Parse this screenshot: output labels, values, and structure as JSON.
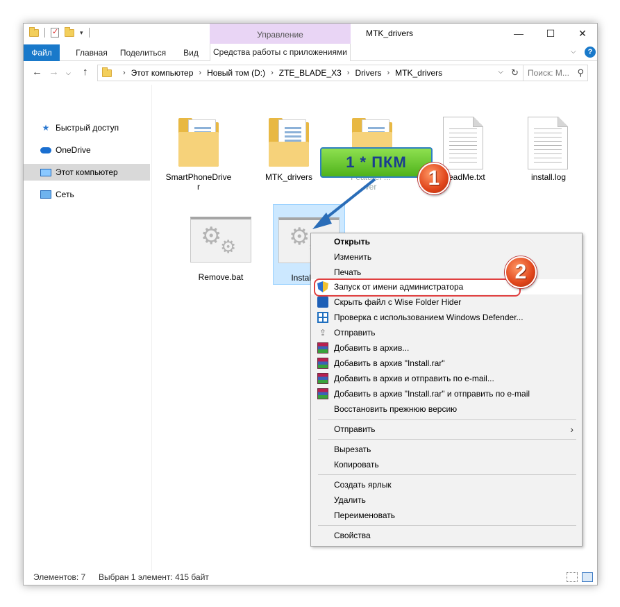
{
  "window": {
    "title": "MTK_drivers",
    "manage_tab": "Управление",
    "minimize": "—",
    "maximize": "☐",
    "close": "✕"
  },
  "ribbon": {
    "tabs": [
      "Файл",
      "Главная",
      "Поделиться",
      "Вид",
      "Средства работы с приложениями"
    ],
    "help": "?"
  },
  "address": {
    "crumbs": [
      "Этот компьютер",
      "Новый том (D:)",
      "ZTE_BLADE_X3",
      "Drivers",
      "MTK_drivers"
    ],
    "search_placeholder": "Поиск: M..."
  },
  "sidebar": {
    "items": [
      "Быстрый доступ",
      "OneDrive",
      "Этот компьютер",
      "Сеть"
    ],
    "selected_index": 2
  },
  "files": [
    {
      "name": "SmartPhoneDrive\nr",
      "type": "folder"
    },
    {
      "name": "MTK_drivers",
      "type": "folder"
    },
    {
      "name": "FeatureP...\nver",
      "type": "folder"
    },
    {
      "name": "ReadMe.txt",
      "type": "document"
    },
    {
      "name": "install.log",
      "type": "document"
    },
    {
      "name": "Remove.bat",
      "type": "batch"
    },
    {
      "name": "Install.bat",
      "type": "batch",
      "selected": true
    }
  ],
  "status": {
    "count": "Элементов: 7",
    "selection": "Выбран 1 элемент: 415 байт"
  },
  "context_menu": {
    "items": [
      {
        "label": "Открыть",
        "bold": true,
        "icon": ""
      },
      {
        "label": "Изменить",
        "icon": ""
      },
      {
        "label": "Печать",
        "icon": ""
      },
      {
        "label": "Запуск от имени администратора",
        "icon": "uac-shield-icon"
      },
      {
        "label": "Скрыть файл с Wise Folder Hider",
        "icon": "wise-folder-hider-icon"
      },
      {
        "label": "Проверка с использованием Windows Defender...",
        "icon": "windows-defender-icon"
      },
      {
        "label": "Отправить",
        "icon": "share-icon"
      },
      {
        "label": "Добавить в архив...",
        "icon": "winrar-icon"
      },
      {
        "label": "Добавить в архив \"Install.rar\"",
        "icon": "winrar-icon"
      },
      {
        "label": "Добавить в архив и отправить по e-mail...",
        "icon": "winrar-icon"
      },
      {
        "label": "Добавить в архив \"Install.rar\" и отправить по e-mail",
        "icon": "winrar-icon"
      },
      {
        "label": "Восстановить прежнюю версию",
        "icon": ""
      },
      {
        "label": "Отправить",
        "icon": "",
        "submenu": true
      },
      {
        "label": "Вырезать",
        "icon": ""
      },
      {
        "label": "Копировать",
        "icon": ""
      },
      {
        "label": "Создать ярлык",
        "icon": ""
      },
      {
        "label": "Удалить",
        "icon": ""
      },
      {
        "label": "Переименовать",
        "icon": ""
      },
      {
        "label": "Свойства",
        "icon": ""
      }
    ],
    "hover_index": 3
  },
  "annotations": {
    "callout_text": "1 *  ПКМ",
    "badge1": "1",
    "badge2": "2"
  },
  "colors": {
    "file_tab": "#1979ca",
    "manage_tab": "#e9d5f5",
    "selection": "#cce8ff",
    "callout": "#5cc22a",
    "highlight": "#e04040"
  }
}
